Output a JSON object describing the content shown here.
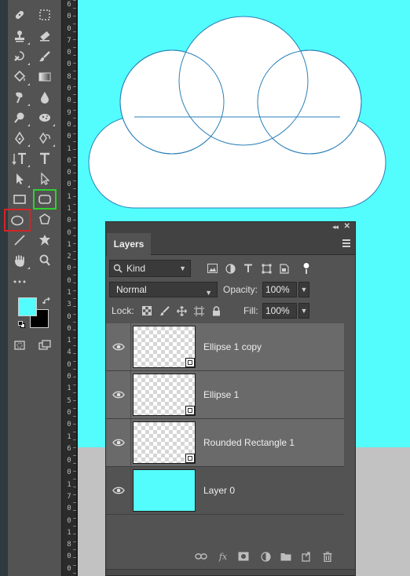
{
  "colors": {
    "canvas_fill": "#53fdfd",
    "pasteboard": "#c2c2c2",
    "shape_stroke": "#2a7fb8",
    "foreground": "#53fdfd",
    "background": "#000000",
    "selected_tool_green": "#2fd12f",
    "selected_tool_red": "#d32525"
  },
  "ruler": {
    "digits": [
      "6",
      "0",
      "0",
      "7",
      "0",
      "0",
      "8",
      "0",
      "0",
      "9",
      "0",
      "0",
      "1",
      "0",
      "0",
      "0",
      "1",
      "1",
      "0",
      "0",
      "1",
      "2",
      "0",
      "0",
      "1",
      "3",
      "0",
      "0",
      "1",
      "4",
      "0",
      "0",
      "1",
      "5",
      "0",
      "0",
      "1",
      "6",
      "0",
      "0",
      "1",
      "7",
      "0",
      "0",
      "1",
      "8",
      "0",
      "0"
    ]
  },
  "tools": [
    {
      "name": "healing-brush-tool",
      "icon": "bandage-icon"
    },
    {
      "name": "marquee-tool",
      "icon": "marquee-icon"
    },
    {
      "name": "stamp-tool",
      "icon": "stamp-icon"
    },
    {
      "name": "eraser-tool",
      "icon": "eraser-icon"
    },
    {
      "name": "history-brush-tool",
      "icon": "history-brush-icon"
    },
    {
      "name": "brush-tool",
      "icon": "brush-icon"
    },
    {
      "name": "paint-bucket-tool",
      "icon": "paint-bucket-icon"
    },
    {
      "name": "gradient-tool",
      "icon": "gradient-icon"
    },
    {
      "name": "smudge-tool",
      "icon": "smudge-icon"
    },
    {
      "name": "blur-tool",
      "icon": "drop-icon"
    },
    {
      "name": "dodge-tool",
      "icon": "dodge-icon"
    },
    {
      "name": "sponge-tool",
      "icon": "sponge-icon"
    },
    {
      "name": "pen-tool",
      "icon": "pen-icon"
    },
    {
      "name": "freeform-pen-tool",
      "icon": "curvature-pen-icon"
    },
    {
      "name": "vertical-type-tool",
      "icon": "vertical-type-icon"
    },
    {
      "name": "type-tool",
      "icon": "type-icon"
    },
    {
      "name": "path-selection-tool",
      "icon": "path-select-icon"
    },
    {
      "name": "direct-selection-tool",
      "icon": "direct-select-icon"
    },
    {
      "name": "rectangle-tool",
      "icon": "rectangle-icon"
    },
    {
      "name": "rounded-rectangle-tool",
      "icon": "rounded-rectangle-icon"
    },
    {
      "name": "ellipse-tool",
      "icon": "ellipse-icon"
    },
    {
      "name": "polygon-tool",
      "icon": "polygon-icon"
    },
    {
      "name": "line-tool",
      "icon": "line-icon"
    },
    {
      "name": "custom-shape-tool",
      "icon": "custom-shape-icon"
    },
    {
      "name": "hand-tool",
      "icon": "hand-icon"
    },
    {
      "name": "zoom-tool",
      "icon": "zoom-icon"
    }
  ],
  "layers_panel": {
    "tab_label": "Layers",
    "filter_kind": "Kind",
    "blend_mode": "Normal",
    "opacity_label": "Opacity:",
    "opacity_value": "100%",
    "lock_label": "Lock:",
    "fill_label": "Fill:",
    "fill_value": "100%",
    "layers": [
      {
        "name": "Ellipse 1 copy",
        "visible": true,
        "thumb": "transparent"
      },
      {
        "name": "Ellipse 1",
        "visible": true,
        "thumb": "transparent"
      },
      {
        "name": "Rounded Rectangle 1",
        "visible": true,
        "thumb": "transparent"
      },
      {
        "name": "Layer 0",
        "visible": true,
        "thumb": "solid"
      }
    ],
    "footer_fx": "fx"
  }
}
